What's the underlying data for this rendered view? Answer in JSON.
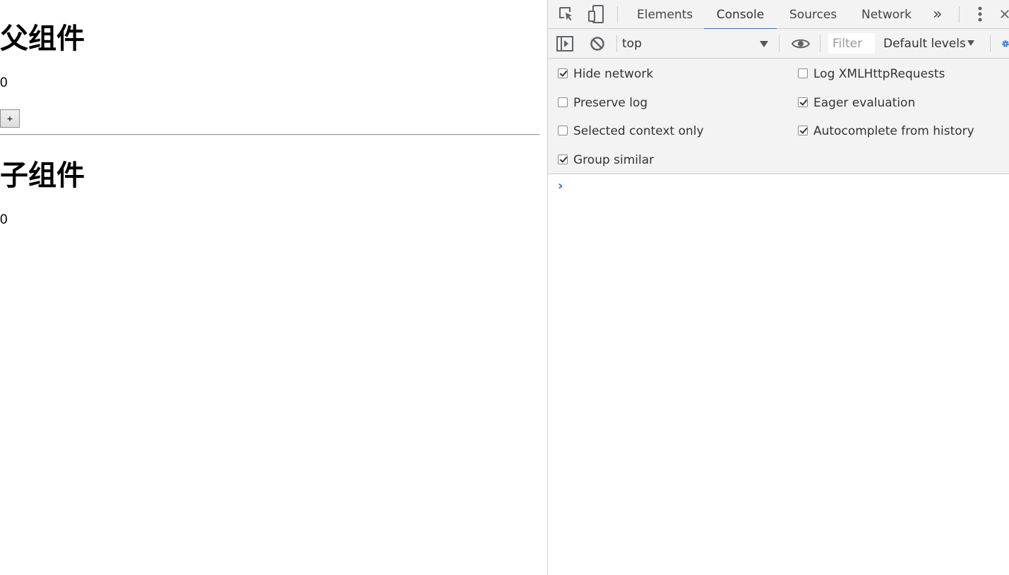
{
  "page": {
    "parent_heading": "父组件",
    "parent_count": "0",
    "plus_button": "+",
    "child_heading": "子组件",
    "child_count": "0"
  },
  "devtools": {
    "tabs": [
      "Elements",
      "Console",
      "Sources",
      "Network"
    ],
    "active_tab": "Console",
    "more_tabs": "»",
    "toolbar": {
      "context": "top",
      "filter_placeholder": "Filter",
      "levels": "Default levels"
    },
    "settings": {
      "hide_network": {
        "label": "Hide network",
        "checked": true
      },
      "preserve_log": {
        "label": "Preserve log",
        "checked": false
      },
      "selected_context_only": {
        "label": "Selected context only",
        "checked": false
      },
      "group_similar": {
        "label": "Group similar",
        "checked": true
      },
      "log_xhr": {
        "label": "Log XMLHttpRequests",
        "checked": false
      },
      "eager_evaluation": {
        "label": "Eager evaluation",
        "checked": true
      },
      "autocomplete_history": {
        "label": "Autocomplete from history",
        "checked": true
      }
    },
    "prompt_symbol": "›",
    "accent_color": "#1a73e8"
  }
}
